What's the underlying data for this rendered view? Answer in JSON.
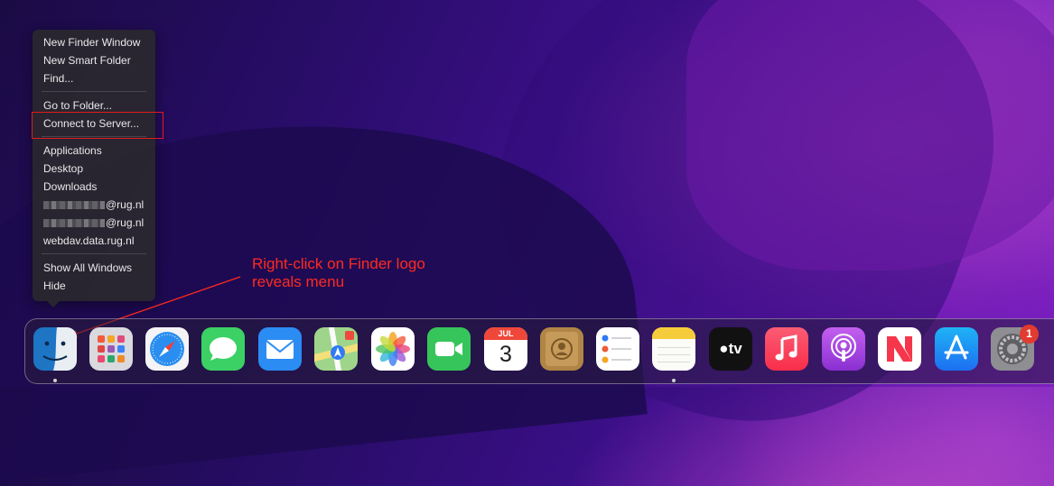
{
  "menu": {
    "items": [
      "New Finder Window",
      "New Smart Folder",
      "Find...",
      "Go to Folder...",
      "Connect to Server...",
      "Applications",
      "Desktop",
      "Downloads",
      "@rug.nl",
      "@rug.nl",
      "webdav.data.rug.nl",
      "Show All Windows",
      "Hide"
    ]
  },
  "annotation": {
    "line1": "Right-click on Finder logo",
    "line2": "reveals menu"
  },
  "dock": {
    "apps": [
      "finder-icon",
      "launchpad-icon",
      "safari-icon",
      "messages-icon",
      "mail-icon",
      "maps-icon",
      "photos-icon",
      "facetime-icon",
      "calendar-icon",
      "contacts-icon",
      "reminders-icon",
      "notes-icon",
      "apple-tv-icon",
      "music-icon",
      "podcasts-icon",
      "news-icon",
      "app-store-icon",
      "system-preferences-icon"
    ],
    "calendar_month": "JUL",
    "calendar_day": "3",
    "tv_label": "tv",
    "settings_badge": "1"
  },
  "colors": {
    "annotation": "#ff2a1f",
    "highlight": "#e21b1b"
  }
}
